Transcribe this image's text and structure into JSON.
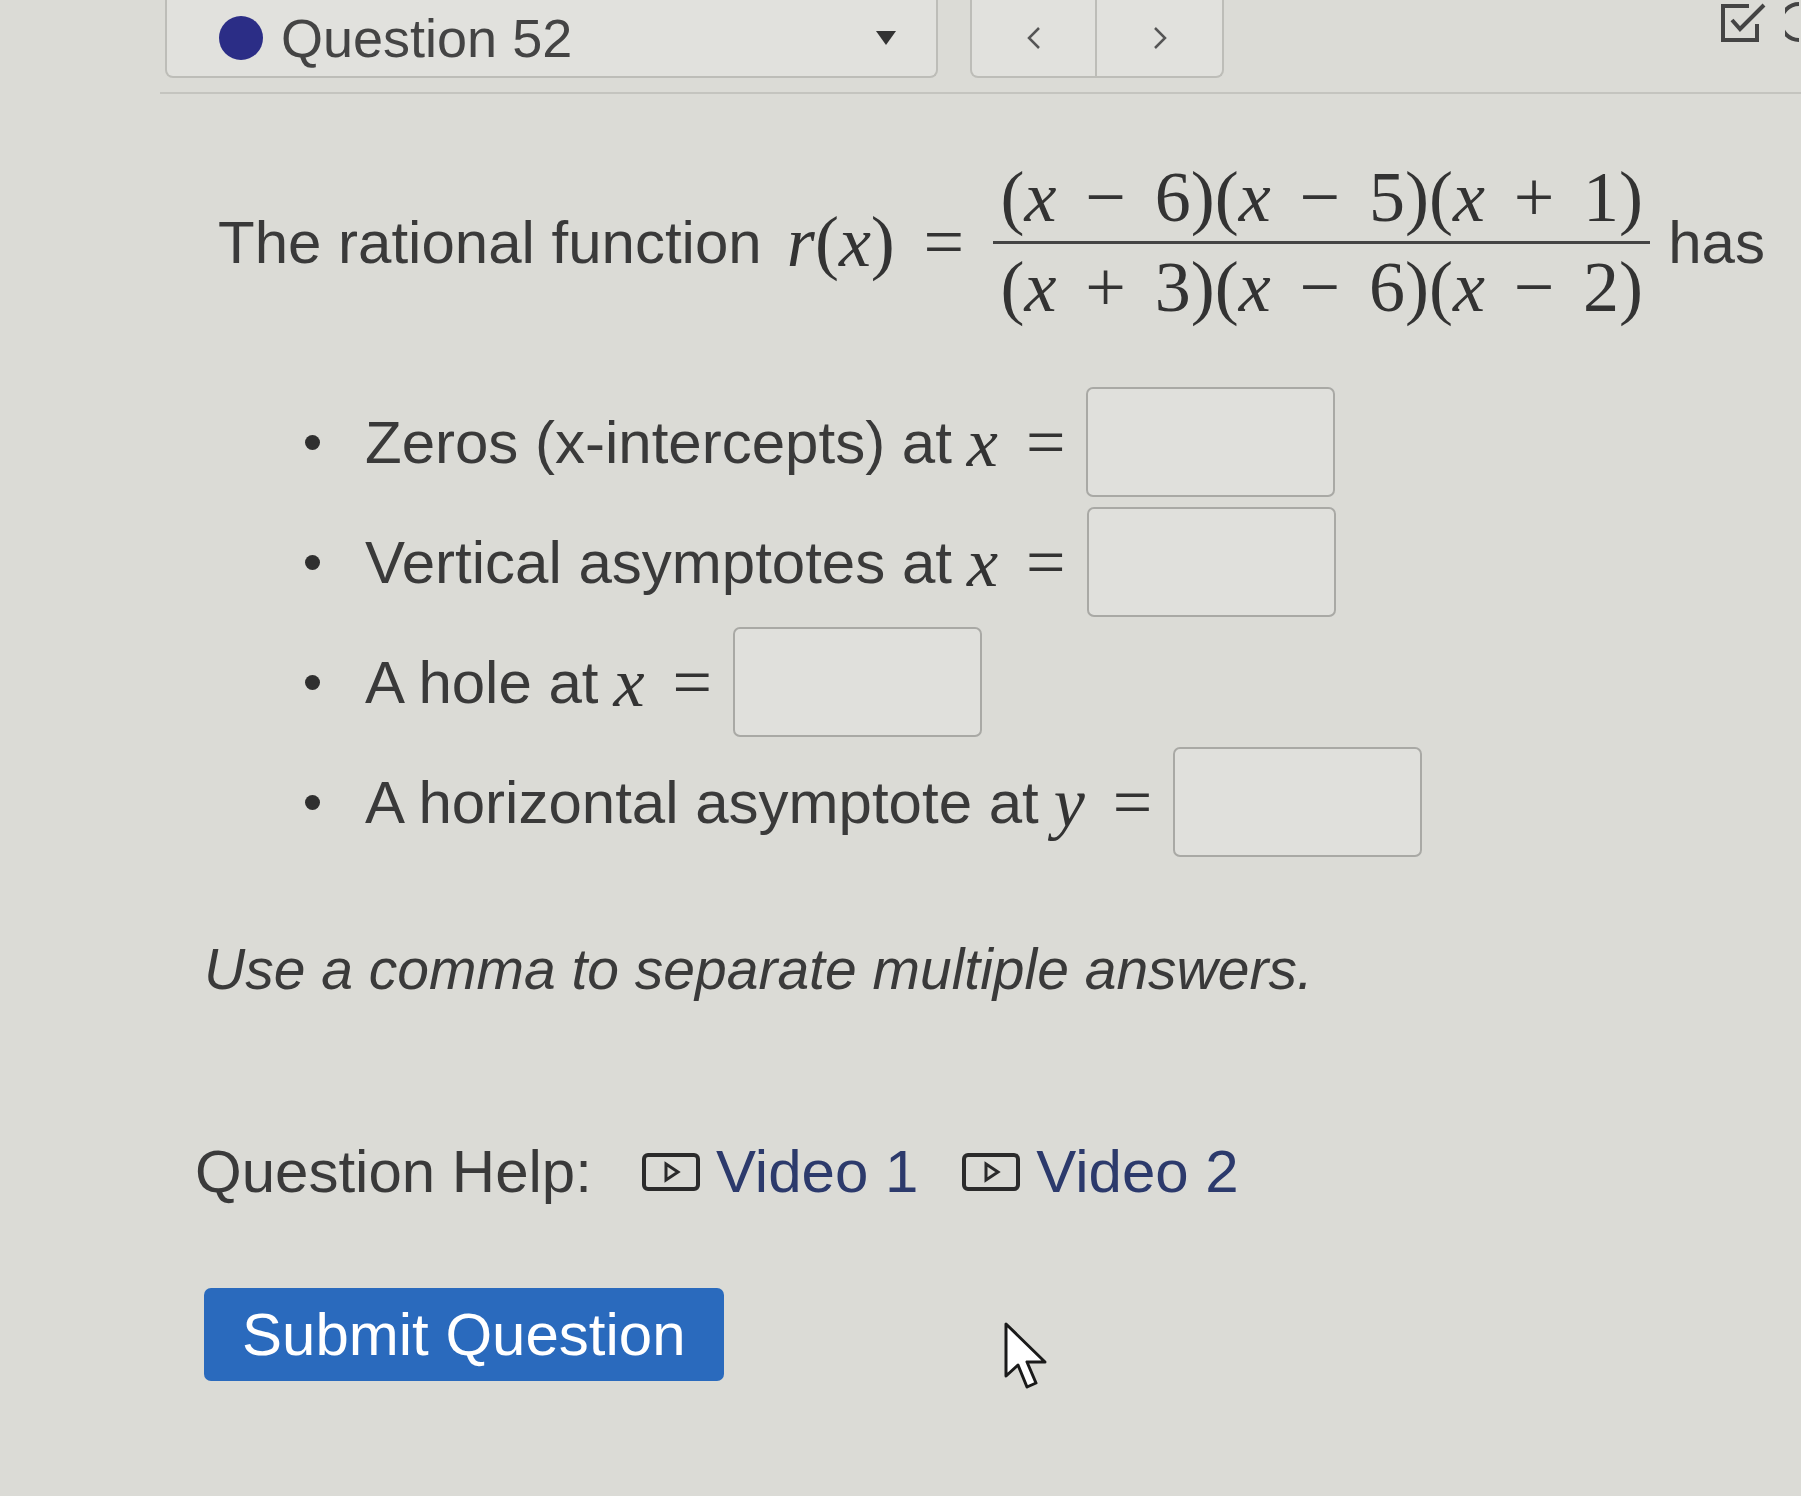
{
  "top_bar": {
    "question_selector": {
      "label": "Question 52"
    }
  },
  "question": {
    "intro": "The rational function",
    "function_name": "*r*(*x*) =",
    "numerator": "(*x* − 6)(*x* − 5)(*x* + 1)",
    "denominator": "(*x* + 3)(*x* − 6)(*x* − 2)",
    "ending": "has"
  },
  "answers": [
    {
      "label": "Zeros (x-intercepts) at",
      "math": "*x* ="
    },
    {
      "label": "Vertical asymptotes at",
      "math": "*x* ="
    },
    {
      "label": "A hole at",
      "math": "*x* ="
    },
    {
      "label": "A horizontal asymptote at",
      "math": "*y* ="
    }
  ],
  "note": "Use a comma to separate multiple answers.",
  "question_help": {
    "label": "Question Help:",
    "links": [
      {
        "label": "Video 1"
      },
      {
        "label": "Video 2"
      }
    ]
  },
  "submit_button": {
    "label": "Submit Question"
  }
}
